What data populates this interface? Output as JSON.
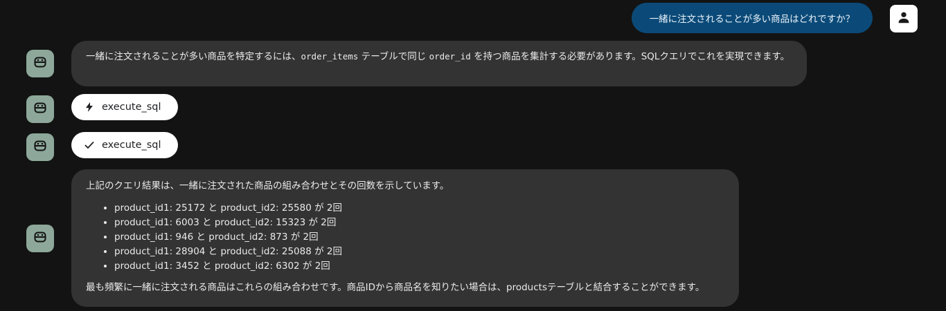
{
  "user_message": {
    "text": "一緒に注文されることが多い商品はどれですか？"
  },
  "assistant_message_1": {
    "text_before": "一緒に注文されることが多い商品を特定するには、",
    "code_1": "order_items",
    "text_middle": " テーブルで同じ ",
    "code_2": "order_id",
    "text_after": " を持つ商品を集計する必要があります。SQLクエリでこれを実現できます。"
  },
  "tool_calls": [
    {
      "label": "execute_sql",
      "icon": "bolt-icon",
      "status": "running"
    },
    {
      "label": "execute_sql",
      "icon": "check-icon",
      "status": "done"
    }
  ],
  "assistant_message_2": {
    "intro": "上記のクエリ結果は、一緒に注文された商品の組み合わせとその回数を示しています。",
    "items": [
      "product_id1: 25172 と product_id2: 25580 が 2回",
      "product_id1: 6003 と product_id2: 15323 が 2回",
      "product_id1: 946 と product_id2: 873 が 2回",
      "product_id1: 28904 と product_id2: 25088 が 2回",
      "product_id1: 3452 と product_id2: 6302 が 2回"
    ],
    "outro": "最も頻繁に一緒に注文される商品はこれらの組み合わせです。商品IDから商品名を知りたい場合は、productsテーブルと結合することができます。"
  },
  "colors": {
    "background": "#131313",
    "user_bubble": "#0b4a78",
    "bot_bubble": "#333333",
    "bot_avatar": "#8da89a",
    "pill": "#ffffff"
  }
}
